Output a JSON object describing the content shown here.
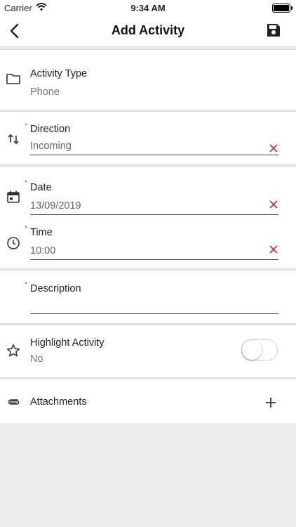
{
  "status_bar": {
    "carrier": "Carrier",
    "time": "9:34 AM"
  },
  "nav": {
    "title": "Add Activity"
  },
  "activity_type": {
    "label": "Activity Type",
    "value": "Phone"
  },
  "direction": {
    "required_mark": "*",
    "label": "Direction",
    "value": "Incoming"
  },
  "date": {
    "required_mark": "*",
    "label": "Date",
    "value": "13/09/2019"
  },
  "time": {
    "required_mark": "*",
    "label": "Time",
    "value": "10:00"
  },
  "description": {
    "required_mark": "*",
    "label": "Description",
    "value": ""
  },
  "highlight": {
    "label": "Highlight Activity",
    "value": "No",
    "enabled": false
  },
  "attachments": {
    "label": "Attachments"
  },
  "colors": {
    "required": "#e53935",
    "clear": "#d32f2f",
    "background": "#ececec"
  }
}
